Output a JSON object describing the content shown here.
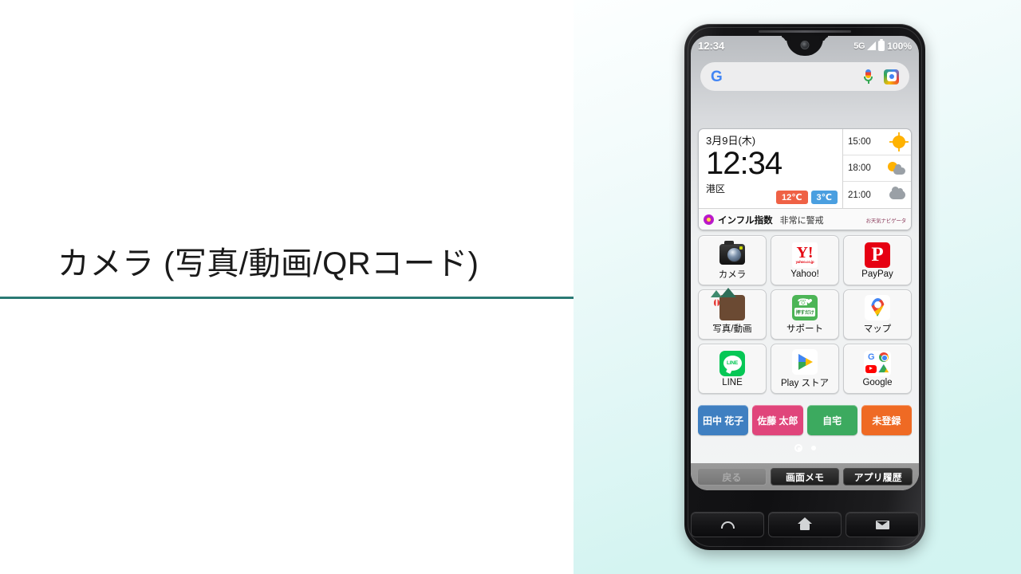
{
  "slide": {
    "title": "カメラ (写真/動画/QRコード)",
    "rule_color": "#2a7a74"
  },
  "phone": {
    "status_bar": {
      "time": "12:34",
      "network": "5G",
      "signal_icon": "signal-bars-icon",
      "battery_icon": "battery-full-icon",
      "battery_pct": "100%"
    },
    "search": {
      "logo": "G",
      "placeholder": "",
      "mic_icon": "microphone-icon",
      "lens_icon": "google-lens-icon"
    },
    "widget": {
      "date": "3月9日(木)",
      "clock": "12:34",
      "area": "港区",
      "forecast": [
        {
          "time": "15:00",
          "icon": "sun-icon"
        },
        {
          "time": "18:00",
          "icon": "sun-cloud-icon"
        },
        {
          "time": "21:00",
          "icon": "cloud-icon"
        }
      ],
      "temp_high": "12℃",
      "temp_low": "3℃",
      "temp_high_color": "#ef6145",
      "temp_low_color": "#4a9fe0",
      "flu_icon": "flower-icon",
      "flu_label": "インフル指数",
      "flu_level": "非常に警戒",
      "provider_logo": "お天気ナビゲータ"
    },
    "apps": [
      [
        {
          "label": "カメラ",
          "icon": "camera-icon"
        },
        {
          "label": "Yahoo!",
          "icon": "yahoo-icon",
          "sub": "yahoo.co.jp"
        },
        {
          "label": "PayPay",
          "icon": "paypay-icon",
          "glyph": "P"
        }
      ],
      [
        {
          "label": "写真/動画",
          "icon": "photo-video-icon"
        },
        {
          "label": "サポート",
          "icon": "support-icon",
          "badge": "押すだけ"
        },
        {
          "label": "マップ",
          "icon": "google-maps-icon"
        }
      ],
      [
        {
          "label": "LINE",
          "icon": "line-icon",
          "glyph": "LINE"
        },
        {
          "label": "Play ストア",
          "icon": "play-store-icon"
        },
        {
          "label": "Google",
          "icon": "google-folder-icon"
        }
      ]
    ],
    "contacts": [
      {
        "label": "田中 花子",
        "color": "#3f7fc1"
      },
      {
        "label": "佐藤 太郎",
        "color": "#e0457b"
      },
      {
        "label": "自宅",
        "color": "#3caa5f"
      },
      {
        "label": "未登録",
        "color": "#ef6a24"
      }
    ],
    "page_dots": {
      "total": 2,
      "active": 0
    },
    "sys_nav": [
      {
        "label": "戻る",
        "state": "disabled"
      },
      {
        "label": "画面メモ",
        "state": "enabled"
      },
      {
        "label": "アプリ履歴",
        "state": "enabled"
      }
    ],
    "hw_buttons": [
      {
        "icon": "phone-call-icon"
      },
      {
        "icon": "home-icon"
      },
      {
        "icon": "mail-icon"
      }
    ]
  }
}
